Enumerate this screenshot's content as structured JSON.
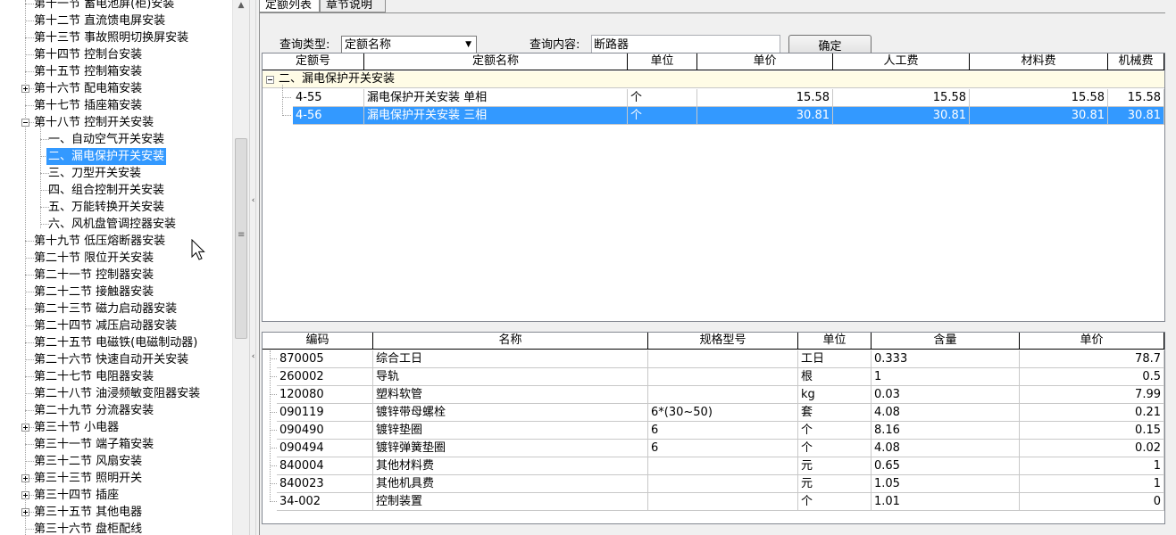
{
  "tree": {
    "items": [
      {
        "label": "第十一节  蓄电池屏(柜)安装",
        "level": 1,
        "expander": "none"
      },
      {
        "label": "第十二节  直流馈电屏安装",
        "level": 1,
        "expander": "none"
      },
      {
        "label": "第十三节  事故照明切换屏安装",
        "level": 1,
        "expander": "none"
      },
      {
        "label": "第十四节  控制台安装",
        "level": 1,
        "expander": "none"
      },
      {
        "label": "第十五节  控制箱安装",
        "level": 1,
        "expander": "none"
      },
      {
        "label": "第十六节  配电箱安装",
        "level": 1,
        "expander": "plus"
      },
      {
        "label": "第十七节  插座箱安装",
        "level": 1,
        "expander": "none"
      },
      {
        "label": "第十八节  控制开关安装",
        "level": 1,
        "expander": "minus"
      },
      {
        "label": "一、自动空气开关安装",
        "level": 2,
        "expander": "none"
      },
      {
        "label": "二、漏电保护开关安装",
        "level": 2,
        "expander": "none",
        "selected": true
      },
      {
        "label": "三、刀型开关安装",
        "level": 2,
        "expander": "none"
      },
      {
        "label": "四、组合控制开关安装",
        "level": 2,
        "expander": "none"
      },
      {
        "label": "五、万能转换开关安装",
        "level": 2,
        "expander": "none"
      },
      {
        "label": "六、风机盘管调控器安装",
        "level": 2,
        "expander": "none"
      },
      {
        "label": "第十九节  低压熔断器安装",
        "level": 1,
        "expander": "none"
      },
      {
        "label": "第二十节  限位开关安装",
        "level": 1,
        "expander": "none"
      },
      {
        "label": "第二十一节  控制器安装",
        "level": 1,
        "expander": "none"
      },
      {
        "label": "第二十二节  接触器安装",
        "level": 1,
        "expander": "none"
      },
      {
        "label": "第二十三节  磁力启动器安装",
        "level": 1,
        "expander": "none"
      },
      {
        "label": "第二十四节  减压启动器安装",
        "level": 1,
        "expander": "none"
      },
      {
        "label": "第二十五节  电磁铁(电磁制动器)",
        "level": 1,
        "expander": "none"
      },
      {
        "label": "第二十六节  快速自动开关安装",
        "level": 1,
        "expander": "none"
      },
      {
        "label": "第二十七节  电阻器安装",
        "level": 1,
        "expander": "none"
      },
      {
        "label": "第二十八节  油浸频敏变阻器安装",
        "level": 1,
        "expander": "none"
      },
      {
        "label": "第二十九节  分流器安装",
        "level": 1,
        "expander": "none"
      },
      {
        "label": "第三十节  小电器",
        "level": 1,
        "expander": "plus"
      },
      {
        "label": "第三十一节  端子箱安装",
        "level": 1,
        "expander": "none"
      },
      {
        "label": "第三十二节  风扇安装",
        "level": 1,
        "expander": "none"
      },
      {
        "label": "第三十三节  照明开关",
        "level": 1,
        "expander": "plus"
      },
      {
        "label": "第三十四节  插座",
        "level": 1,
        "expander": "plus"
      },
      {
        "label": "第三十五节  其他电器",
        "level": 1,
        "expander": "plus"
      },
      {
        "label": "第三十六节  盘柜配线",
        "level": 1,
        "expander": "none"
      }
    ]
  },
  "tabs": [
    {
      "label": "定额列表",
      "active": true
    },
    {
      "label": "章节说明",
      "active": false
    }
  ],
  "query": {
    "type_label": "查询类型:",
    "type_value": "定额名称",
    "content_label": "查询内容:",
    "content_value": "断路器",
    "confirm_label": "确定"
  },
  "quota_table": {
    "headers": [
      "定额号",
      "定额名称",
      "单位",
      "单价",
      "人工费",
      "材料费",
      "机械费"
    ],
    "group": {
      "label": "二、漏电保护开关安装"
    },
    "rows": [
      {
        "code": "4-55",
        "name": "漏电保护开关安装  单相",
        "unit": "个",
        "price": "15.58",
        "labor": "15.58",
        "material": "15.58",
        "machine": "15.58",
        "selected": false
      },
      {
        "code": "4-56",
        "name": "漏电保护开关安装  三相",
        "unit": "个",
        "price": "30.81",
        "labor": "30.81",
        "material": "30.81",
        "machine": "30.81",
        "selected": true
      }
    ]
  },
  "material_table": {
    "headers": [
      "编码",
      "名称",
      "规格型号",
      "单位",
      "含量",
      "单价"
    ],
    "rows": [
      {
        "code": "870005",
        "name": "综合工日",
        "spec": "",
        "unit": "工日",
        "qty": "0.333",
        "price": "78.7"
      },
      {
        "code": "260002",
        "name": "导轨",
        "spec": "",
        "unit": "根",
        "qty": "1",
        "price": "0.5"
      },
      {
        "code": "120080",
        "name": "塑料软管",
        "spec": "",
        "unit": "kg",
        "qty": "0.03",
        "price": "7.99"
      },
      {
        "code": "090119",
        "name": "镀锌带母螺栓",
        "spec": "6*(30~50)",
        "unit": "套",
        "qty": "4.08",
        "price": "0.21"
      },
      {
        "code": "090490",
        "name": "镀锌垫圈",
        "spec": "6",
        "unit": "个",
        "qty": "8.16",
        "price": "0.15"
      },
      {
        "code": "090494",
        "name": "镀锌弹簧垫圈",
        "spec": "6",
        "unit": "个",
        "qty": "4.08",
        "price": "0.02"
      },
      {
        "code": "840004",
        "name": "其他材料费",
        "spec": "",
        "unit": "元",
        "qty": "0.65",
        "price": "1"
      },
      {
        "code": "840023",
        "name": "其他机具费",
        "spec": "",
        "unit": "元",
        "qty": "1.05",
        "price": "1"
      },
      {
        "code": "34-002",
        "name": "控制装置",
        "spec": "",
        "unit": "个",
        "qty": "1.01",
        "price": "0"
      }
    ]
  },
  "colors": {
    "selection": "#3399ff",
    "group_row": "#fffce6"
  }
}
